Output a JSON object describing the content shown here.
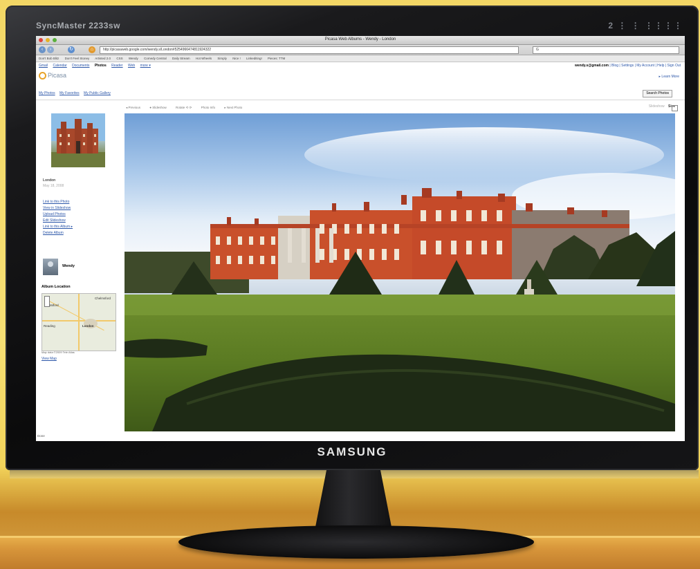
{
  "monitor": {
    "model": "SyncMaster 2233sw",
    "model_right": "2 ⋮ ⋮ ⋮⋮⋮⋮",
    "brand": "SAMSUNG"
  },
  "browser": {
    "window_title": "Picasa Web Albums - Wendy - London",
    "url": "http://picasaweb.google.com/wendy.s/London#5254966474811924322",
    "search_placeholder": "G",
    "bookmarks": [
      "Don't Bob Blitz",
      "Don't Feel Stoney",
      "Artisted 2.0",
      "CSS",
      "Wendy",
      "Comedy Central",
      "Daily Stream",
      "Hot Wheels",
      "Simply",
      "Nice !",
      "Linkediting!",
      "Pieces: TTM"
    ],
    "status": "Done"
  },
  "google_bar": {
    "links": [
      "Gmail",
      "Calendar",
      "Documents",
      "Photos",
      "Reader",
      "Web",
      "more ▾"
    ],
    "active": "Photos",
    "account_email": "wendy.s@gmail.com",
    "account_links": "| Blog | Settings | My Account | Help | Sign Out"
  },
  "picasa": {
    "logo_text": "Picasa",
    "help_link": "▸ Learn More",
    "nav_links": [
      "My Photos",
      "My Favorites",
      "My Public Gallery"
    ],
    "search_button": "Search Photos",
    "photo_tools": [
      "◂ Previous",
      "● Slideshow",
      "Rotate ⟲ ⟳",
      "Photo Info",
      "▸ Next Photo"
    ],
    "size_label": "Size",
    "size_value": "Slideshow"
  },
  "album": {
    "title": "London",
    "meta": "May 18, 2008",
    "links": [
      "Link to this Photo",
      "View in Slideshow",
      "Upload Photos",
      "Edit Slideshow",
      "Link to this Album ▸",
      "Delete Album"
    ],
    "owner": "Wendy",
    "map_heading": "Album Location",
    "map_labels": [
      "Chelmsford",
      "London",
      "Reading",
      "Watford"
    ],
    "map_copyright": "Map data ©2009 Tele Atlas",
    "view_map": "View Map"
  },
  "colors": {
    "wall": "#f3d766",
    "desk": "#d7953a",
    "bezel": "#0b0b0c",
    "link": "#2a55a8",
    "palace_brick": "#c9502b"
  }
}
